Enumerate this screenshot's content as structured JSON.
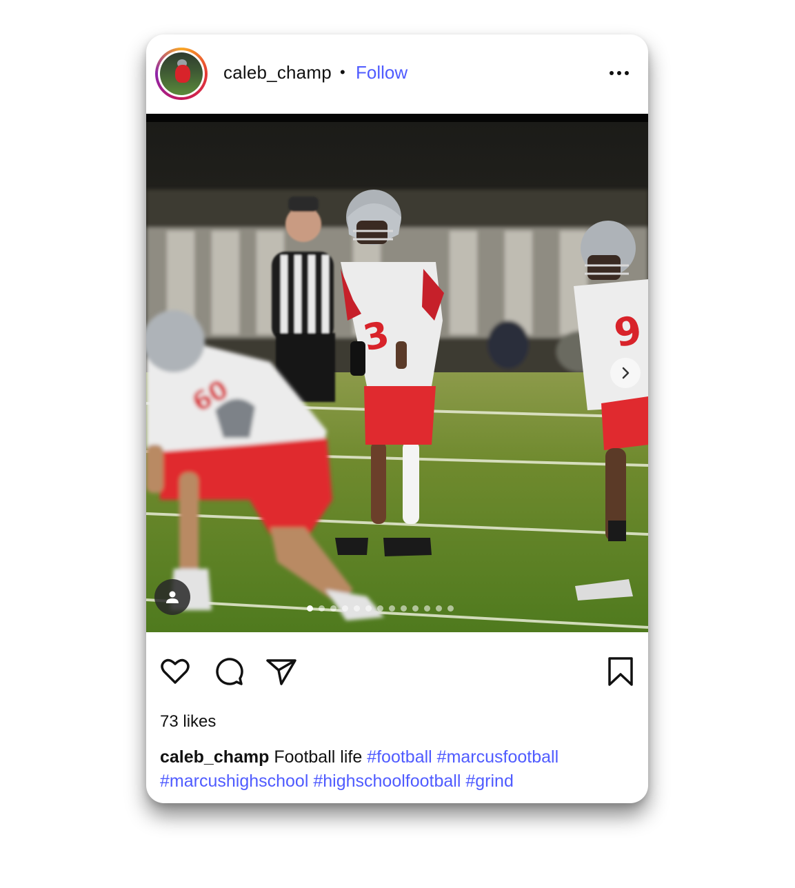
{
  "post": {
    "username": "caleb_champ",
    "separator": "•",
    "follow_label": "Follow",
    "more_icon": "more-horizontal-icon",
    "likes_text": "73 likes",
    "caption_user": "caleb_champ",
    "caption_text": "Football life",
    "hashtags": [
      "#football",
      "#marcusfootball",
      "#marcushighschool",
      "#highschoolfootball",
      "#grind"
    ],
    "carousel": {
      "slide_count": 13,
      "active_index": 0
    }
  },
  "icons": {
    "like": "heart-icon",
    "comment": "comment-icon",
    "share": "paper-plane-icon",
    "save": "bookmark-icon",
    "next": "chevron-right-icon",
    "tagged_user": "user-icon"
  },
  "colors": {
    "link_blue": "#4f5bff",
    "ring_start": "#f9a825",
    "ring_end": "#c2185b",
    "jersey_red": "#d8232a"
  }
}
